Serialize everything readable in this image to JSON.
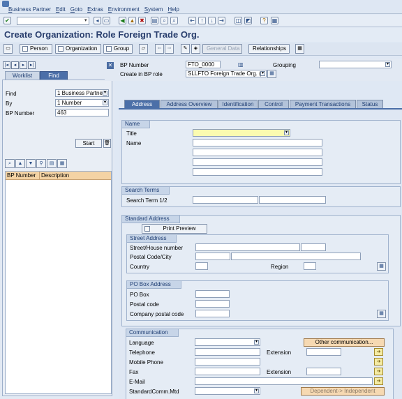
{
  "menu": [
    "Business Partner",
    "Edit",
    "Goto",
    "Extras",
    "Environment",
    "System",
    "Help"
  ],
  "title": "Create Organization: Role Foreign Trade Org.",
  "app_toolbar": {
    "person": "Person",
    "organization": "Organization",
    "group": "Group",
    "general_data": "General Data",
    "relationships": "Relationships"
  },
  "left": {
    "tabs": [
      "Worklist",
      "Find"
    ],
    "find_label": "Find",
    "find_value": "1 Business Partne",
    "by_label": "By",
    "by_value": "1 Number",
    "bp_number_label": "BP Number",
    "bp_number_value": "463",
    "start": "Start",
    "grid_columns": [
      "BP Number",
      "Description"
    ]
  },
  "header": {
    "bp_number_label": "BP Number",
    "bp_number_value": "FTO_0000",
    "grouping_label": "Grouping",
    "role_label": "Create in BP role",
    "role_value": "SLLFTO Foreign Trade Org. (N"
  },
  "tabs": [
    "Address",
    "Address Overview",
    "Identification",
    "Control",
    "Payment Transactions",
    "Status"
  ],
  "name_group": {
    "title": "Name",
    "title_label": "Title",
    "name_label": "Name"
  },
  "search_terms": {
    "title": "Search Terms",
    "term_label": "Search Term 1/2"
  },
  "standard_address": {
    "title": "Standard Address",
    "print_preview": "Print Preview",
    "street_title": "Street Address",
    "street_label": "Street/House number",
    "postal_label": "Postal Code/City",
    "country_label": "Country",
    "region_label": "Region",
    "pobox_title": "PO Box Address",
    "pobox_label": "PO Box",
    "pobox_postal_label": "Postal code",
    "company_postal_label": "Company postal code"
  },
  "communication": {
    "title": "Communication",
    "language": "Language",
    "telephone": "Telephone",
    "extension": "Extension",
    "mobile": "Mobile Phone",
    "fax": "Fax",
    "fax_extension": "Extension",
    "email": "E-Mail",
    "std_comm": "StandardComm.Mtd",
    "other_comm": "Other communication...",
    "dependent": "Dependent-> Independent"
  }
}
